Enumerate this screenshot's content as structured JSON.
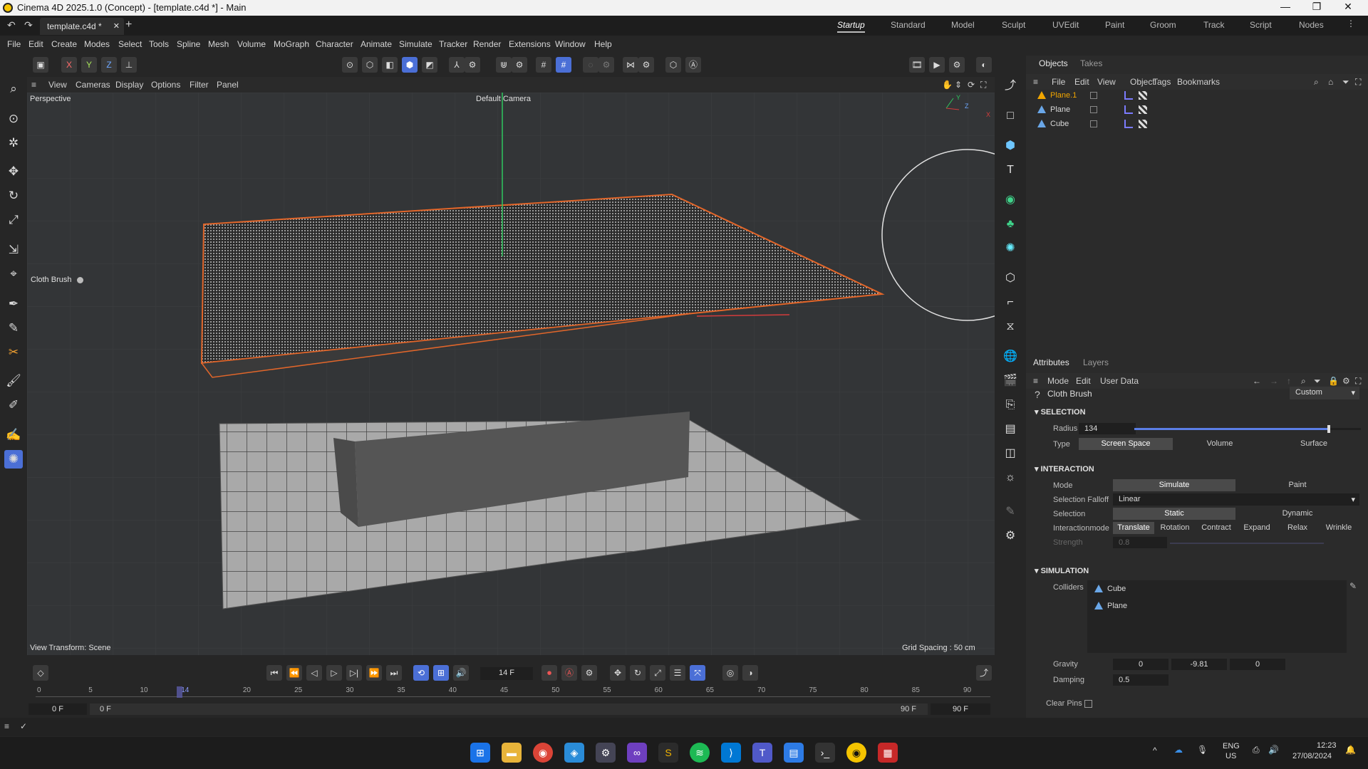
{
  "window": {
    "title": "Cinema 4D 2025.1.0 (Concept) - [template.c4d *] - Main",
    "doc_tab": "template.c4d *",
    "min": "—",
    "max": "❐",
    "close": "✕"
  },
  "layouts": [
    "Startup",
    "Standard",
    "Model",
    "Sculpt",
    "UVEdit",
    "Paint",
    "Groom",
    "Track",
    "Script",
    "Nodes"
  ],
  "menu": [
    "File",
    "Edit",
    "Create",
    "Modes",
    "Select",
    "Tools",
    "Spline",
    "Mesh",
    "Volume",
    "MoGraph",
    "Character",
    "Animate",
    "Simulate",
    "Tracker",
    "Render",
    "Extensions",
    "Window",
    "Help"
  ],
  "axes": {
    "x": "X",
    "y": "Y",
    "z": "Z"
  },
  "viewport": {
    "menu": [
      "View",
      "Cameras",
      "Display",
      "Options",
      "Filter",
      "Panel"
    ],
    "label": "Perspective",
    "camera": "Default Camera",
    "brush": "Cloth Brush",
    "transform": "View Transform: Scene",
    "grid": "Grid Spacing : 50 cm"
  },
  "objects": {
    "tabs": [
      "Objects",
      "Takes"
    ],
    "menu": [
      "File",
      "Edit",
      "View",
      "Object",
      "Tags",
      "Bookmarks"
    ],
    "items": [
      "Plane.1",
      "Plane",
      "Cube"
    ]
  },
  "attributes": {
    "tabs": [
      "Attributes",
      "Layers"
    ],
    "menu": [
      "Mode",
      "Edit",
      "User Data"
    ],
    "tool": "Cloth Brush",
    "preset": "Custom",
    "selection": {
      "title": "SELECTION",
      "radius_label": "Radius",
      "radius": "134",
      "radius_frac": 0.86,
      "type_label": "Type",
      "types": [
        "Screen Space",
        "Volume",
        "Surface"
      ]
    },
    "interaction": {
      "title": "INTERACTION",
      "mode_label": "Mode",
      "modes": [
        "Simulate",
        "Paint"
      ],
      "falloff_label": "Selection Falloff",
      "falloff": "Linear",
      "sel_label": "Selection",
      "sels": [
        "Static",
        "Dynamic"
      ],
      "imode_label": "Interactionmode",
      "imodes": [
        "Translate",
        "Rotation",
        "Contract",
        "Expand",
        "Relax",
        "Wrinkle"
      ],
      "strength_label": "Strength",
      "strength": "0.8"
    },
    "simulation": {
      "title": "SIMULATION",
      "colliders_label": "Colliders",
      "colliders": [
        "Cube",
        "Plane"
      ],
      "gravity_label": "Gravity",
      "gravity": [
        "0",
        "-9.81",
        "0"
      ],
      "damping_label": "Damping",
      "damping": "0.5",
      "pins_label": "Clear Pins"
    }
  },
  "timeline": {
    "frame": "14 F",
    "ticks": [
      "0",
      "5",
      "10",
      "14",
      "20",
      "25",
      "30",
      "35",
      "40",
      "45",
      "50",
      "55",
      "60",
      "65",
      "70",
      "75",
      "80",
      "85",
      "90"
    ],
    "current": 14,
    "start": "0 F",
    "start2": "0 F",
    "end": "90 F",
    "end2": "90 F"
  },
  "taskbar": {
    "lang": "ENG",
    "region": "US",
    "time": "12:23",
    "date": "27/08/2024"
  }
}
